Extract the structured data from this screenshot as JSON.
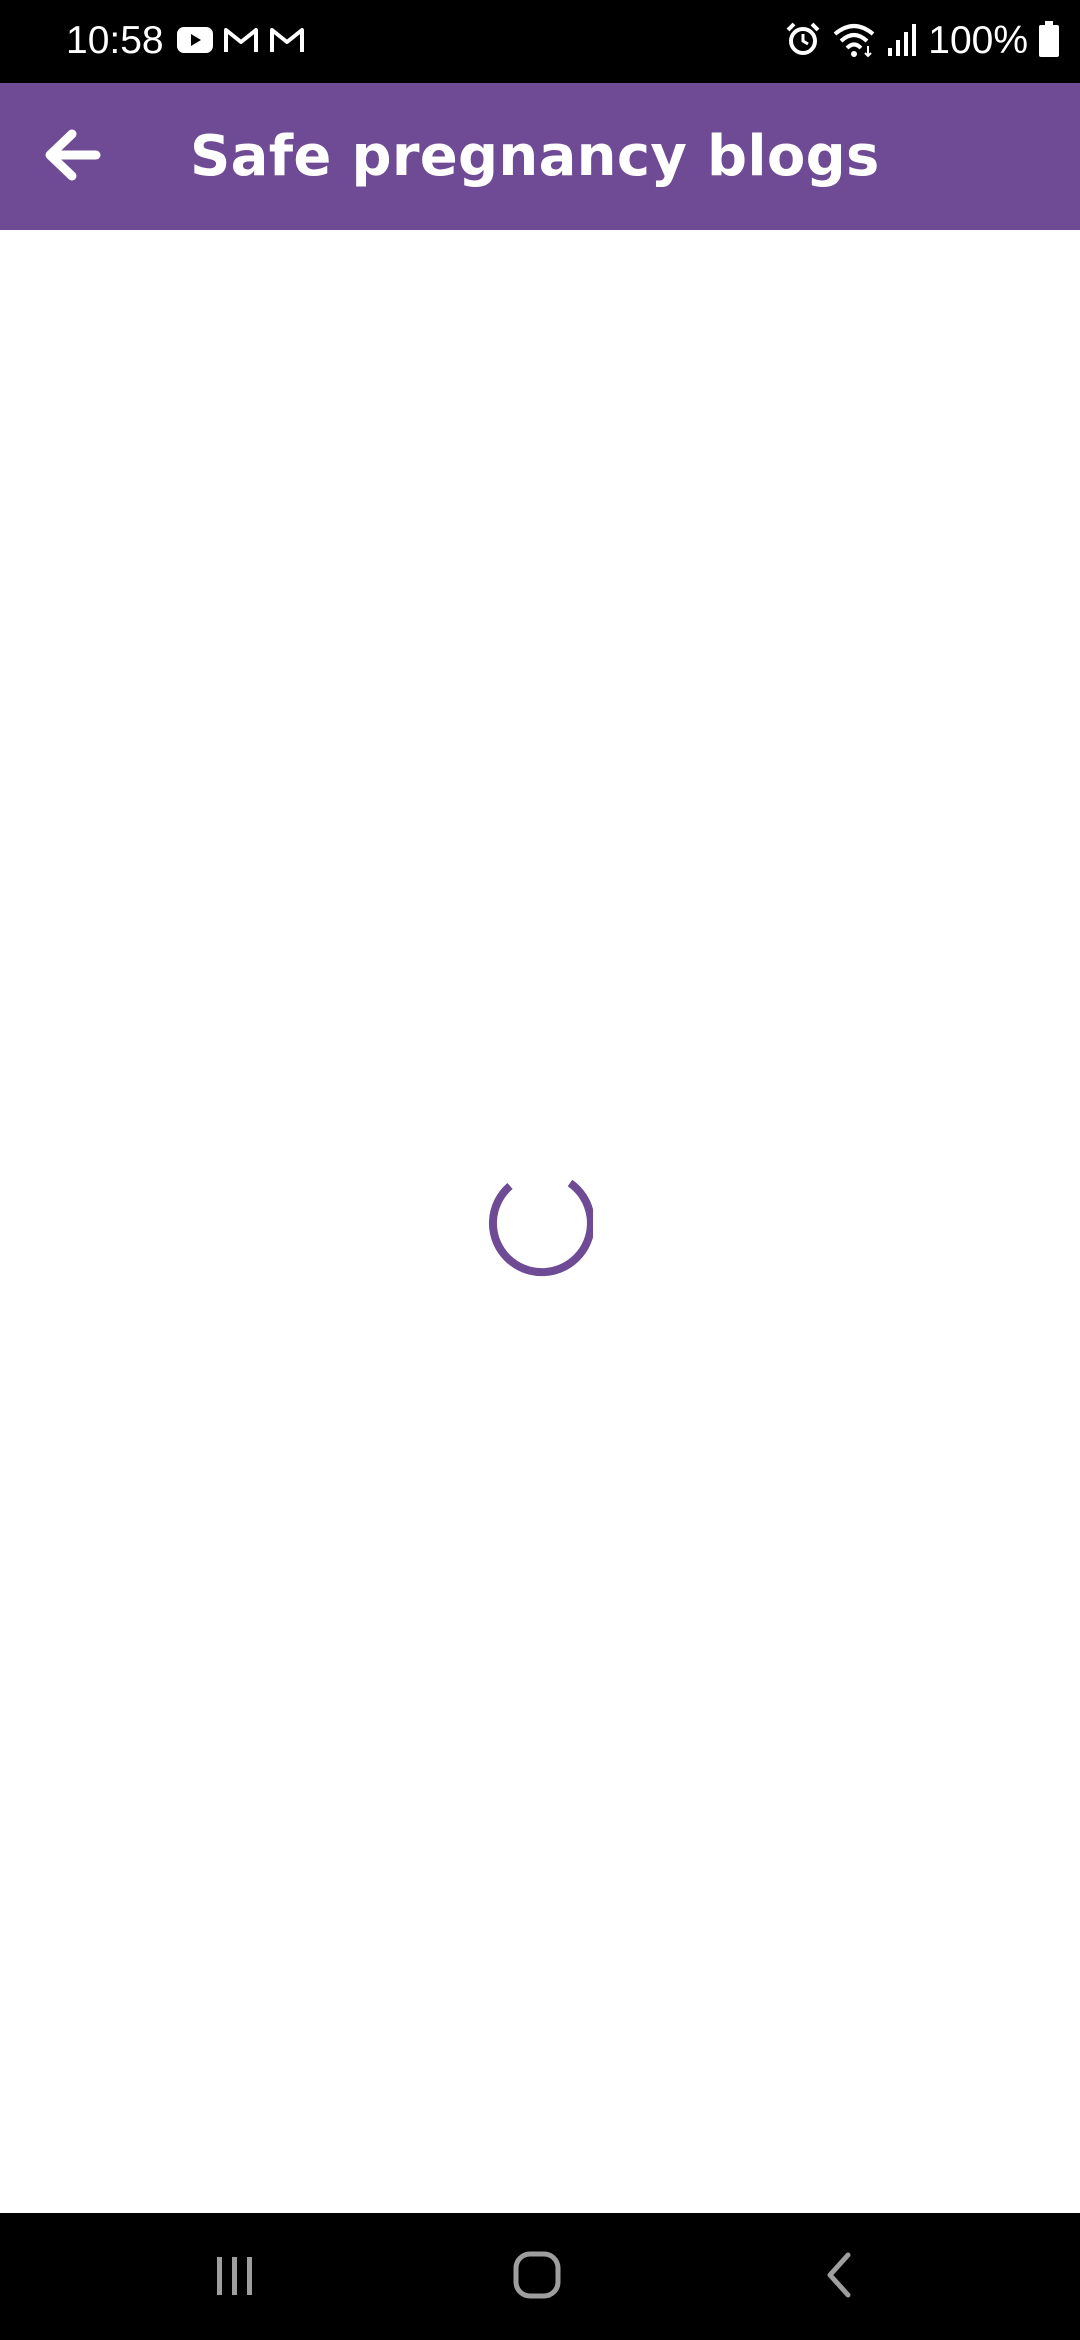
{
  "status_bar": {
    "time": "10:58",
    "battery_text": "100%",
    "notification_icons": [
      "youtube-icon",
      "gmail-icon",
      "gmail-icon"
    ],
    "system_icons": [
      "alarm-icon",
      "wifi-icon",
      "signal-icon",
      "battery-icon"
    ]
  },
  "app_bar": {
    "title": "Safe pregnancy blogs",
    "back_icon": "arrow-left-icon",
    "background_color": "#6f4b96"
  },
  "content": {
    "state": "loading",
    "spinner_color": "#6f4b96"
  },
  "nav_bar": {
    "buttons": [
      "recent-apps-icon",
      "home-icon",
      "back-icon"
    ]
  }
}
